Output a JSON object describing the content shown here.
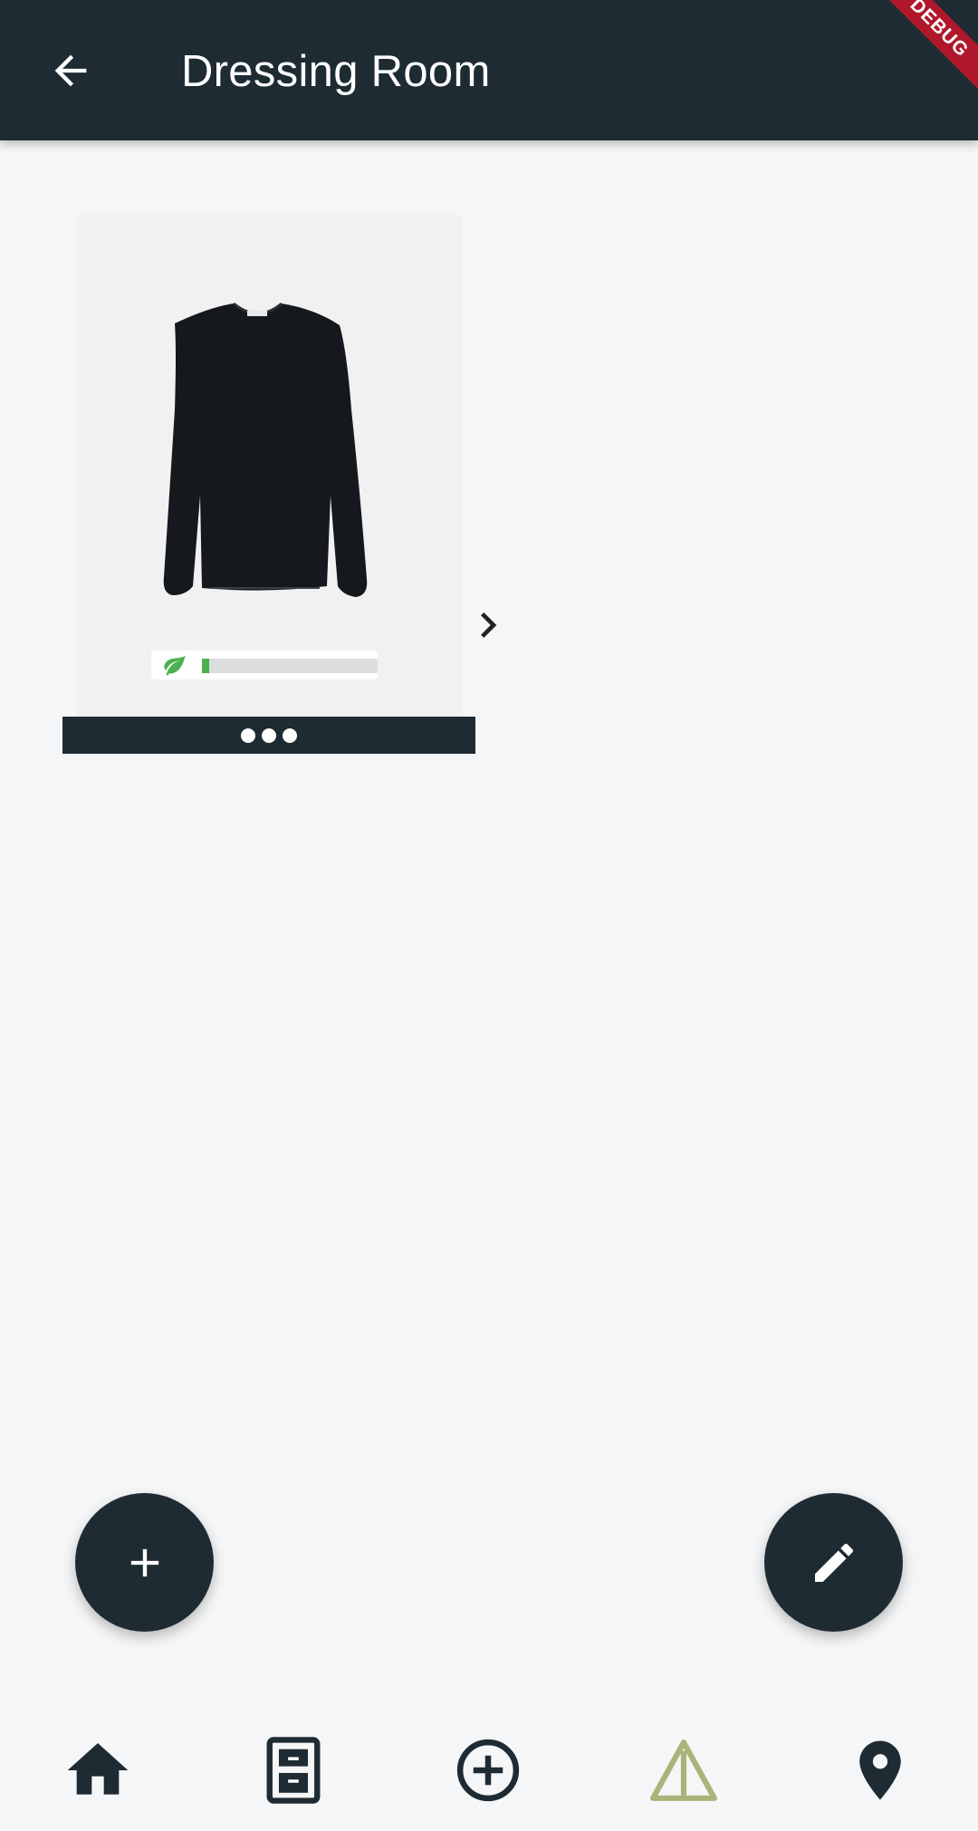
{
  "appbar": {
    "title": "Dressing Room",
    "back_icon": "arrow-back-icon",
    "debug_banner": "DEBUG"
  },
  "card": {
    "image": "black-sweater-image",
    "next_icon": "chevron-right-icon",
    "eco_icon": "leaf-icon",
    "eco_score": 0.04,
    "more_icon": "more-horizontal-icon"
  },
  "fabs": {
    "add_icon": "plus-icon",
    "edit_icon": "pencil-icon"
  },
  "bottom_nav": {
    "items": [
      {
        "icon": "home-icon",
        "selected": true
      },
      {
        "icon": "wardrobe-icon",
        "selected": false
      },
      {
        "icon": "add-circle-icon",
        "selected": false
      },
      {
        "icon": "warning-triangle-icon",
        "selected": false
      },
      {
        "icon": "location-pin-icon",
        "selected": false
      }
    ]
  },
  "colors": {
    "primary": "#1f2b33",
    "background": "#f5f6f7",
    "accent_leaf": "#4caf50",
    "alert_icon": "#a9b47a",
    "debug_ribbon": "#b0172a"
  }
}
